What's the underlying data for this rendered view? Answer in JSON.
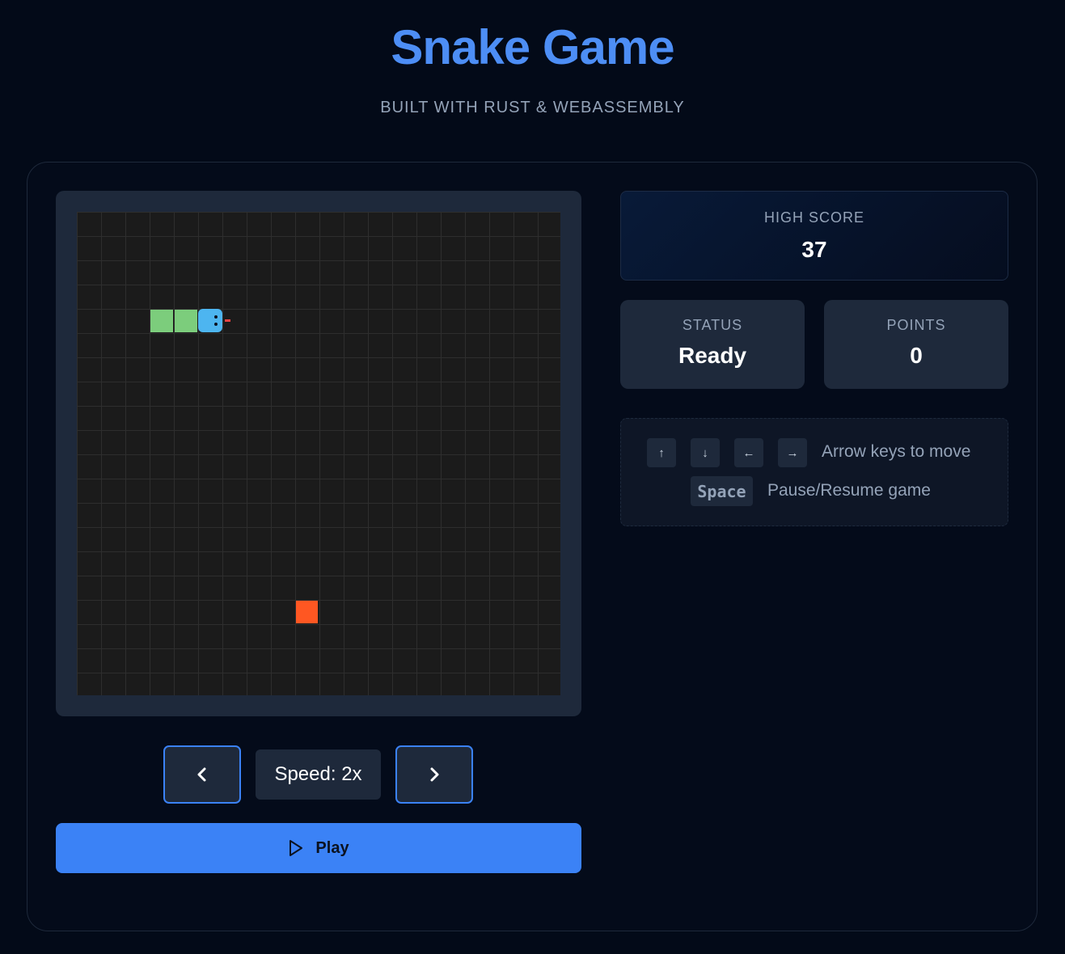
{
  "header": {
    "title": "Snake Game",
    "subtitle": "BUILT WITH RUST & WEBASSEMBLY"
  },
  "board": {
    "grid_columns": 20,
    "grid_rows": 20,
    "snake": [
      {
        "col": 5,
        "row": 4,
        "part": "head",
        "direction": "right"
      },
      {
        "col": 4,
        "row": 4,
        "part": "body"
      },
      {
        "col": 3,
        "row": 4,
        "part": "body"
      }
    ],
    "food": {
      "col": 9,
      "row": 16
    },
    "colors": {
      "cell": "#1b1b1b",
      "grid_line": "#2e2e2e",
      "snake_body": "#7ccd7c",
      "snake_head": "#4db5f0",
      "food": "#ff5722"
    }
  },
  "controls": {
    "decrease_speed_icon": "chevron-left-icon",
    "increase_speed_icon": "chevron-right-icon",
    "speed_label": "Speed: 2x",
    "play_label": "Play",
    "play_icon": "play-icon"
  },
  "stats": {
    "high_score_label": "HIGH SCORE",
    "high_score_value": "37",
    "status_label": "STATUS",
    "status_value": "Ready",
    "points_label": "POINTS",
    "points_value": "0"
  },
  "help": {
    "keys": [
      "↑",
      "↓",
      "←",
      "→"
    ],
    "arrows_text": "Arrow keys to move",
    "space_key": "Space",
    "space_text": "Pause/Resume game"
  },
  "accent_color": "#3b82f6"
}
